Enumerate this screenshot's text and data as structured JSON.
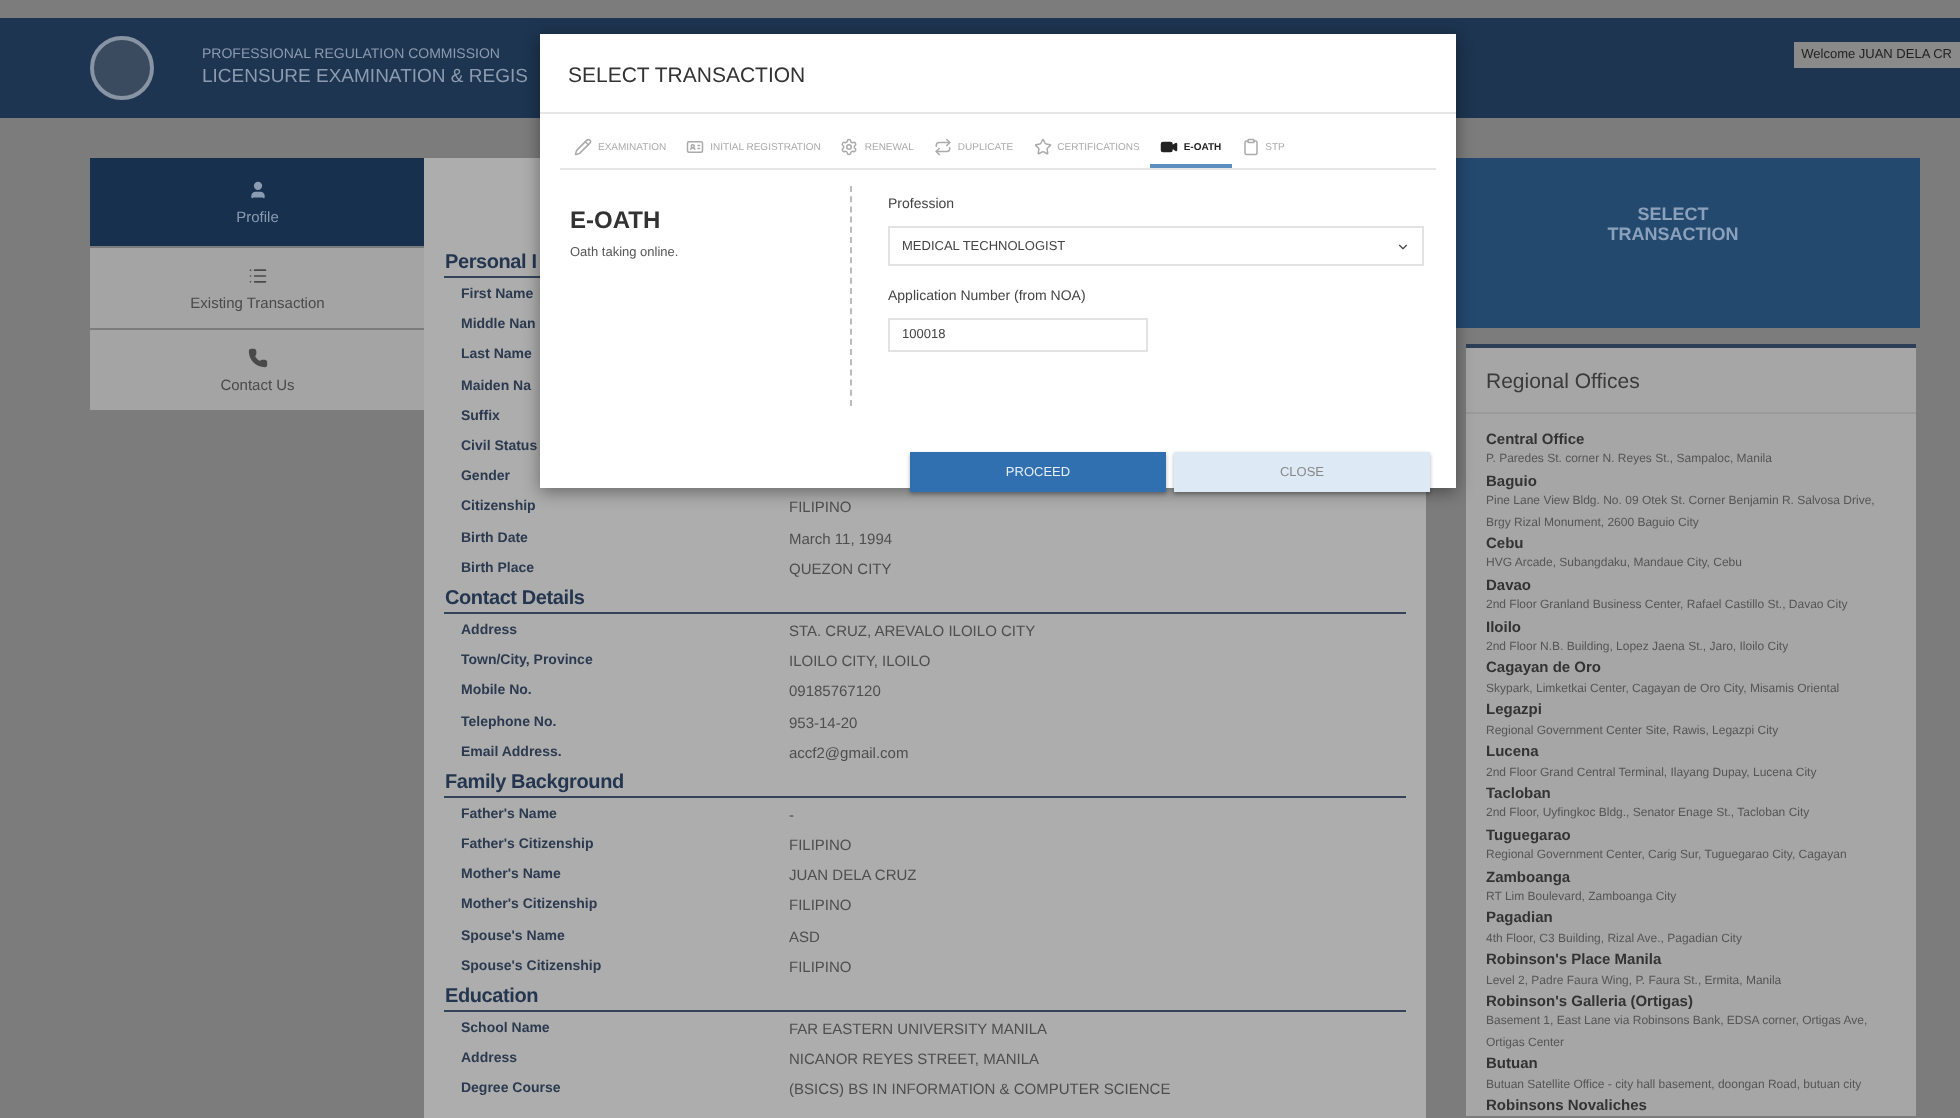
{
  "header": {
    "subtitle": "PROFESSIONAL REGULATION COMMISSION",
    "title": "LICENSURE EXAMINATION & REGIS",
    "welcome": "Welcome JUAN DELA CR"
  },
  "sidebar": {
    "items": [
      {
        "label": "Profile",
        "selected": true
      },
      {
        "label": "Existing Transaction",
        "selected": false
      },
      {
        "label": "Contact Us",
        "selected": false
      }
    ]
  },
  "profile": {
    "sections": [
      {
        "heading": "Personal I",
        "rows": [
          {
            "label": "First Name"
          },
          {
            "label": "Middle Nan"
          },
          {
            "label": "Last Name"
          },
          {
            "label": "Maiden Na"
          },
          {
            "label": "Suffix"
          },
          {
            "label": "Civil Status"
          },
          {
            "label": "Gender"
          },
          {
            "label": "Citizenship",
            "value": "FILIPINO"
          },
          {
            "label": "Birth Date",
            "value": "March 11, 1994"
          },
          {
            "label": "Birth Place",
            "value": "QUEZON CITY"
          }
        ]
      },
      {
        "heading": "Contact Details",
        "rows": [
          {
            "label": "Address",
            "value": "STA. CRUZ, AREVALO ILOILO CITY"
          },
          {
            "label": "Town/City, Province",
            "value": "ILOILO CITY, ILOILO"
          },
          {
            "label": "Mobile No.",
            "value": "09185767120"
          },
          {
            "label": "Telephone No.",
            "value": "953-14-20"
          },
          {
            "label": "Email Address.",
            "value": "accf2@gmail.com"
          }
        ]
      },
      {
        "heading": "Family Background",
        "rows": [
          {
            "label": "Father's Name",
            "value": "-"
          },
          {
            "label": "Father's Citizenship",
            "value": "FILIPINO"
          },
          {
            "label": "Mother's Name",
            "value": "JUAN DELA CRUZ"
          },
          {
            "label": "Mother's Citizenship",
            "value": "FILIPINO"
          },
          {
            "label": "Spouse's Name",
            "value": "ASD"
          },
          {
            "label": "Spouse's Citizenship",
            "value": "FILIPINO"
          }
        ]
      },
      {
        "heading": "Education",
        "rows": [
          {
            "label": "School Name",
            "value": "FAR EASTERN UNIVERSITY MANILA"
          },
          {
            "label": "Address",
            "value": "NICANOR REYES STREET, MANILA"
          },
          {
            "label": "Degree Course",
            "value": "(BSICS) BS IN INFORMATION & COMPUTER SCIENCE"
          }
        ]
      }
    ]
  },
  "select_transaction_panel": {
    "label": "SELECT TRANSACTION"
  },
  "regional_offices": {
    "title": "Regional Offices",
    "offices": [
      {
        "name": "Central Office",
        "address": "P. Paredes St. corner N. Reyes St., Sampaloc, Manila"
      },
      {
        "name": "Baguio",
        "address": "Pine Lane View Bldg. No. 09 Otek St. Corner Benjamin R. Salvosa Drive, Brgy Rizal Monument, 2600 Baguio City"
      },
      {
        "name": "Cebu",
        "address": "HVG Arcade, Subangdaku, Mandaue City, Cebu"
      },
      {
        "name": "Davao",
        "address": "2nd Floor Granland Business Center, Rafael Castillo St., Davao City"
      },
      {
        "name": "Iloilo",
        "address": "2nd Floor N.B. Building, Lopez Jaena St., Jaro, Iloilo City"
      },
      {
        "name": "Cagayan de Oro",
        "address": "Skypark, Limketkai Center, Cagayan de Oro City, Misamis Oriental"
      },
      {
        "name": "Legazpi",
        "address": "Regional Government Center Site, Rawis, Legazpi City"
      },
      {
        "name": "Lucena",
        "address": "2nd Floor Grand Central Terminal, Ilayang Dupay, Lucena City"
      },
      {
        "name": "Tacloban",
        "address": "2nd Floor, Uyfingkoc Bldg., Senator Enage St., Tacloban City"
      },
      {
        "name": "Tuguegarao",
        "address": "Regional Government Center, Carig Sur, Tuguegarao City, Cagayan"
      },
      {
        "name": "Zamboanga",
        "address": "RT Lim Boulevard, Zamboanga City"
      },
      {
        "name": "Pagadian",
        "address": "4th Floor, C3 Building, Rizal Ave., Pagadian City"
      },
      {
        "name": "Robinson's Place Manila",
        "address": "Level 2, Padre Faura Wing, P. Faura St., Ermita, Manila"
      },
      {
        "name": "Robinson's Galleria (Ortigas)",
        "address": "Basement 1, East Lane via Robinsons Bank, EDSA corner, Ortigas Ave, Ortigas Center"
      },
      {
        "name": "Butuan",
        "address": "Butuan Satellite Office - city hall basement, doongan Road, butuan city"
      },
      {
        "name": "Robinsons Novaliches"
      }
    ]
  },
  "modal": {
    "title": "SELECT TRANSACTION",
    "tabs": [
      {
        "label": "EXAMINATION",
        "selected": false
      },
      {
        "label": "INITIAL REGISTRATION",
        "selected": false
      },
      {
        "label": "RENEWAL",
        "selected": false
      },
      {
        "label": "DUPLICATE",
        "selected": false
      },
      {
        "label": "CERTIFICATIONS",
        "selected": false
      },
      {
        "label": "E-OATH",
        "selected": true
      },
      {
        "label": "STP",
        "selected": false
      }
    ],
    "heading": "E-OATH",
    "description": "Oath taking online.",
    "profession": {
      "label": "Profession",
      "value": "MEDICAL TECHNOLOGIST"
    },
    "application_number": {
      "label": "Application Number (from NOA)",
      "value": "100018"
    },
    "buttons": [
      {
        "label": "PROCEED",
        "kind": "primary"
      },
      {
        "label": "CLOSE",
        "kind": "secondary"
      }
    ]
  }
}
